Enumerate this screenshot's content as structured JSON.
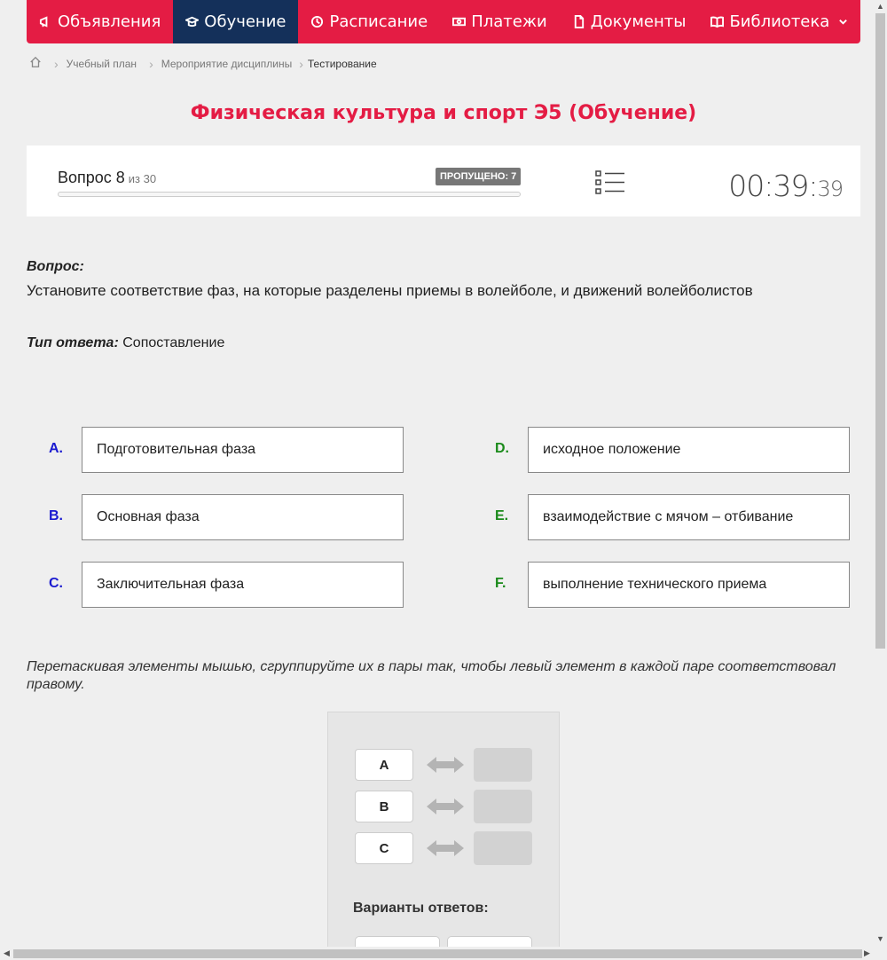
{
  "nav": {
    "items": [
      {
        "label": "Объявления",
        "icon": "megaphone-icon"
      },
      {
        "label": "Обучение",
        "icon": "graduation-cap-icon"
      },
      {
        "label": "Расписание",
        "icon": "clock-icon"
      },
      {
        "label": "Платежи",
        "icon": "money-icon"
      },
      {
        "label": "Документы",
        "icon": "document-icon"
      },
      {
        "label": "Библиотека",
        "icon": "book-icon"
      }
    ]
  },
  "breadcrumb": {
    "home_icon": "home-icon",
    "items": [
      "Учебный план",
      "Мероприятие дисциплины",
      "Тестирование"
    ]
  },
  "page": {
    "title": "Физическая культура и спорт Э5 (Обучение)"
  },
  "question_panel": {
    "question_label": "Вопрос 8",
    "of_total": "из 30",
    "skipped": "ПРОПУЩЕНО: 7",
    "progress": 0.0,
    "timer_main": "00:39:",
    "timer_seconds": "39"
  },
  "question": {
    "label": "Вопрос:",
    "text": "Установите соответствие фаз, на которые разделены приемы в волейболе, и движений волейболистов",
    "answer_type_label": "Тип ответа:",
    "answer_type": "Сопоставление"
  },
  "left_items": [
    {
      "letter": "A.",
      "text": "Подготовительная фаза"
    },
    {
      "letter": "B.",
      "text": "Основная фаза"
    },
    {
      "letter": "C.",
      "text": "Заключительная фаза"
    }
  ],
  "right_items": [
    {
      "letter": "D.",
      "text": "исходное положение"
    },
    {
      "letter": "E.",
      "text": "взаимодействие с мячом – отбивание"
    },
    {
      "letter": "F.",
      "text": "выполнение технического приема"
    }
  ],
  "instruction": "Перетаскивая элементы мышью, сгруппируйте их в пары так, чтобы левый элемент в каждой паре соответствовал правому.",
  "drag": {
    "pairs": [
      "A",
      "B",
      "C"
    ],
    "variants_label": "Варианты ответов:"
  },
  "colors": {
    "brand": "#e41c44",
    "nav_active": "#14305a",
    "left_letter": "#1a1ad0",
    "right_letter": "#1a8a1a"
  }
}
